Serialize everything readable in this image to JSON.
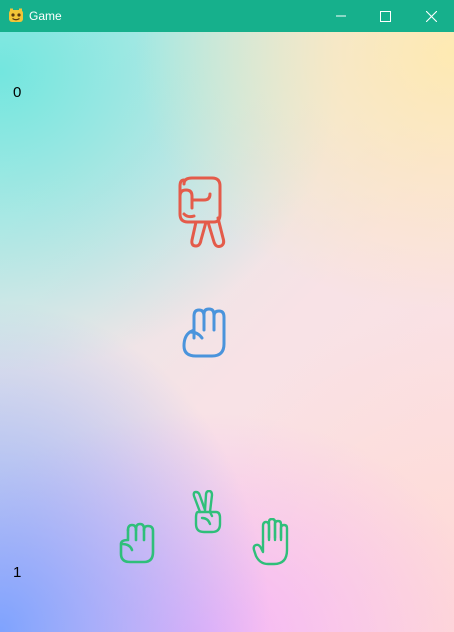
{
  "window": {
    "title": "Game",
    "titlebar_color": "#16b08c",
    "controls": [
      "minimize-icon",
      "maximize-icon",
      "close-icon"
    ]
  },
  "game": {
    "opponent_score": "0",
    "player_score": "1",
    "opponent_hand": {
      "gesture": "scissors",
      "color": "#e45b4a"
    },
    "player_hand": {
      "gesture": "rock",
      "color": "#4a94dc"
    },
    "choices": [
      {
        "gesture": "rock",
        "color": "#2fbf7a"
      },
      {
        "gesture": "scissors",
        "color": "#2fbf7a"
      },
      {
        "gesture": "paper",
        "color": "#2fbf7a"
      }
    ]
  }
}
